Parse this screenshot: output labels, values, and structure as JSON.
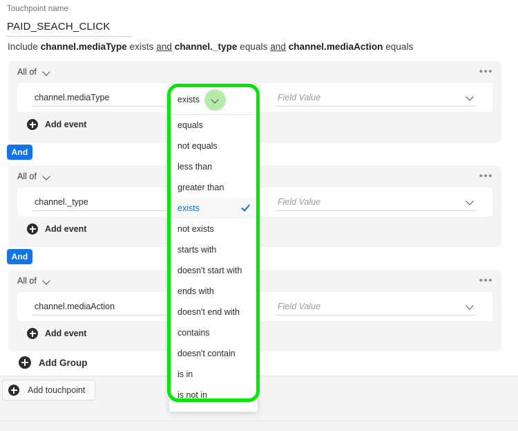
{
  "form": {
    "touchpoint_name_label": "Touchpoint name",
    "touchpoint_name_value": "PAID_SEACH_CLICK",
    "summary_prefix": "Include",
    "summary_field_1": "channel.mediaType",
    "summary_op_1": "exists",
    "summary_join_1": "and",
    "summary_field_2": "channel._type",
    "summary_op_2": "equals",
    "summary_join_2": "and",
    "summary_field_3": "channel.mediaAction",
    "summary_op_3": "equals"
  },
  "groups": [
    {
      "logic_label": "All of",
      "menu_icon": "•••",
      "field": "channel.mediaType",
      "operator": "exists",
      "value": "",
      "value_placeholder": "Field Value",
      "add_event_label": "Add event"
    },
    {
      "logic_label": "All of",
      "menu_icon": "•••",
      "field": "channel._type",
      "operator": "equals",
      "value": "",
      "value_placeholder": "Field Value",
      "add_event_label": "Add event"
    },
    {
      "logic_label": "All of",
      "menu_icon": "•••",
      "field": "channel.mediaAction",
      "operator": "equals",
      "value": "",
      "value_placeholder": "Field Value",
      "add_event_label": "Add event"
    }
  ],
  "connectors": {
    "and_1": "And",
    "and_2": "And"
  },
  "actions": {
    "add_group_label": "Add Group",
    "add_touchpoint_label": "Add touchpoint"
  },
  "operator_dropdown": {
    "trigger_value": "exists",
    "selected": "exists",
    "items": [
      "equals",
      "not equals",
      "less than",
      "greater than",
      "exists",
      "not exists",
      "starts with",
      "doesn't start with",
      "ends with",
      "doesn't end with",
      "contains",
      "doesn't contain",
      "is in",
      "is not in"
    ]
  },
  "colors": {
    "accent_blue": "#1473e6",
    "highlight_green": "#00e800",
    "highlight_dot_green": "#b7ebaa",
    "group_bg": "#f4f4f4"
  }
}
